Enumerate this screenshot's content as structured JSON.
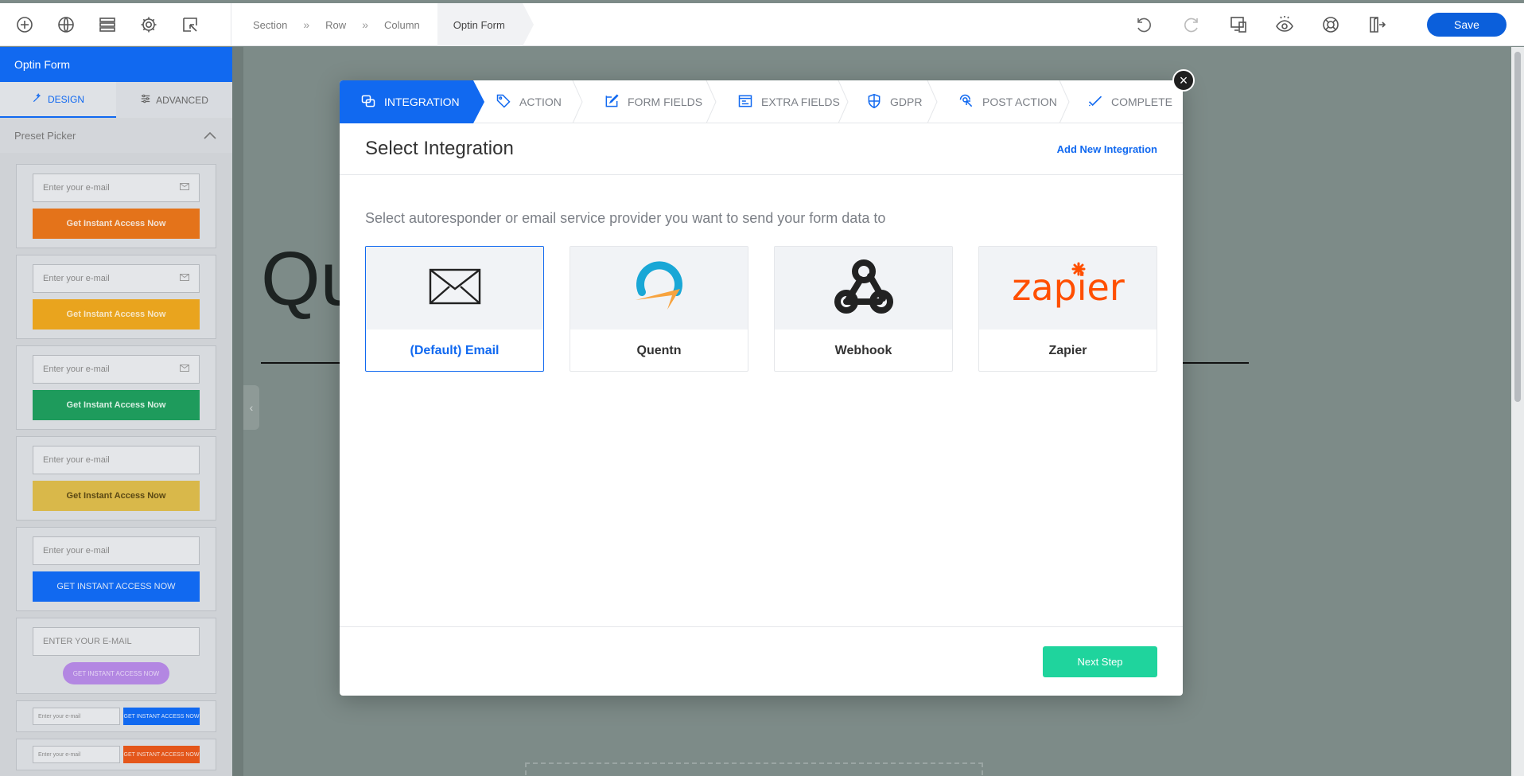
{
  "topbar": {
    "tools": [
      {
        "icon": "add-circle-icon"
      },
      {
        "icon": "globe-icon"
      },
      {
        "icon": "layers-icon"
      },
      {
        "icon": "gear-icon"
      },
      {
        "icon": "cursor-select-icon"
      }
    ],
    "breadcrumb": {
      "items": [
        "Section",
        "Row",
        "Column"
      ],
      "separator": "»",
      "active": "Optin Form"
    },
    "right_tools": [
      "undo-icon",
      "redo-icon",
      "responsive-icon",
      "preview-eye-icon",
      "help-lifebuoy-icon",
      "exit-icon"
    ],
    "save_label": "Save",
    "accent": "#0b5fdb"
  },
  "sidebar": {
    "title": "Optin Form",
    "tabs": [
      {
        "label": "DESIGN",
        "icon": "magic-wand-icon",
        "active": true
      },
      {
        "label": "ADVANCED",
        "icon": "sliders-icon",
        "active": false
      }
    ],
    "section_label": "Preset Picker",
    "presets": [
      {
        "placeholder": "Enter your e-mail",
        "button": "Get Instant Access Now",
        "button_color": "#e4731a",
        "button_text_color": "#f3e2d3",
        "has_mail_icon": true
      },
      {
        "placeholder": "Enter your e-mail",
        "button": "Get Instant Access Now",
        "button_color": "#e9a41e",
        "button_text_color": "#f6e6c6",
        "has_mail_icon": true
      },
      {
        "placeholder": "Enter your e-mail",
        "button": "Get Instant Access Now",
        "button_color": "#1e9b5c",
        "button_text_color": "#d8efe2",
        "has_mail_icon": true
      },
      {
        "placeholder": "Enter your e-mail",
        "button": "Get Instant Access Now",
        "button_color": "#d9b84a",
        "button_text_color": "#5a4814",
        "has_mail_icon": false
      },
      {
        "placeholder": "Enter your e-mail",
        "button": "GET INSTANT ACCESS NOW",
        "button_color": "#1169f0",
        "button_text_color": "#dbe6f7",
        "has_mail_icon": false
      },
      {
        "placeholder": "ENTER YOUR E-MAIL",
        "button": "GET INSTANT ACCESS NOW",
        "button_color": "#b387e2",
        "button_text_color": "#e4d6f3",
        "has_mail_icon": false
      },
      {
        "placeholder": "Enter your e-mail",
        "button": "GET INSTANT ACCESS NOW",
        "button_color": "#1169f0",
        "button_text_color": "#dbe6f7",
        "inline": true
      },
      {
        "placeholder": "Enter your e-mail",
        "button": "GET INSTANT ACCESS NOW",
        "button_color": "#e4561a",
        "button_text_color": "#f3dcd2",
        "inline": true
      }
    ]
  },
  "canvas": {
    "heading_fragment": "Qu"
  },
  "modal": {
    "steps": [
      {
        "label": "INTEGRATION",
        "icon": "integration-icon",
        "active": true
      },
      {
        "label": "ACTION",
        "icon": "tag-icon",
        "active": false
      },
      {
        "label": "FORM FIELDS",
        "icon": "edit-icon",
        "active": false
      },
      {
        "label": "EXTRA FIELDS",
        "icon": "form-icon",
        "active": false
      },
      {
        "label": "GDPR",
        "icon": "shield-icon",
        "active": false
      },
      {
        "label": "POST ACTION",
        "icon": "click-icon",
        "active": false
      },
      {
        "label": "COMPLETE",
        "icon": "check-icon",
        "active": false
      }
    ],
    "title": "Select Integration",
    "add_link": "Add New Integration",
    "intro": "Select autoresponder or email service provider you want to send your form data to",
    "integrations": [
      {
        "label": "(Default) Email",
        "icon": "envelope-icon",
        "selected": true
      },
      {
        "label": "Quentn",
        "icon": "quentn-logo",
        "selected": false
      },
      {
        "label": "Webhook",
        "icon": "webhook-icon",
        "selected": false
      },
      {
        "label": "Zapier",
        "icon": "zapier-logo",
        "selected": false
      }
    ],
    "next_label": "Next Step",
    "close_symbol": "×",
    "colors": {
      "primary": "#1169f0",
      "next": "#1fd49d"
    }
  }
}
